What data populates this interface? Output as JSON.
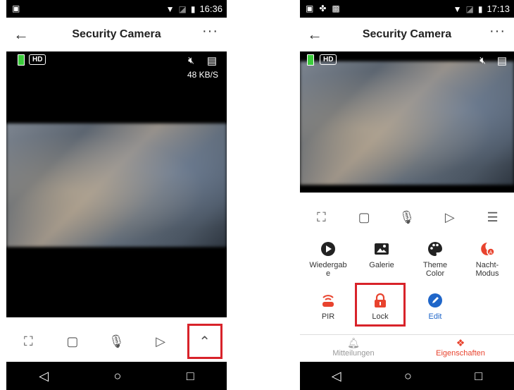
{
  "left": {
    "status_time": "16:36",
    "app_title": "Security Camera",
    "hd_label": "HD",
    "speed": "48 KB/S"
  },
  "right": {
    "status_time": "17:13",
    "app_title": "Security Camera",
    "hd_label": "HD",
    "features": [
      {
        "label": "Wiedergab\ne",
        "icon": "play-circle-icon",
        "color": "#222222"
      },
      {
        "label": "Galerie",
        "icon": "image-icon",
        "color": "#222222"
      },
      {
        "label": "Theme\nColor",
        "icon": "palette-icon",
        "color": "#222222"
      },
      {
        "label": "Nacht-\nModus",
        "icon": "night-mode-icon",
        "color": "#e8432e"
      },
      {
        "label": "PIR",
        "icon": "pir-sensor-icon",
        "color": "#e8432e"
      },
      {
        "label": "Lock",
        "icon": "lock-icon",
        "color": "#e8432e"
      },
      {
        "label": "Edit",
        "icon": "edit-icon",
        "color": "#1f66c9"
      }
    ],
    "tabs": [
      {
        "label": "Mitteilungen",
        "color": "#999999"
      },
      {
        "label": "Eigenschaften",
        "color": "#e8432e"
      }
    ]
  },
  "colors": {
    "accent_red": "#e8432e",
    "highlight_red": "#d8232a",
    "edit_blue": "#1f66c9"
  }
}
